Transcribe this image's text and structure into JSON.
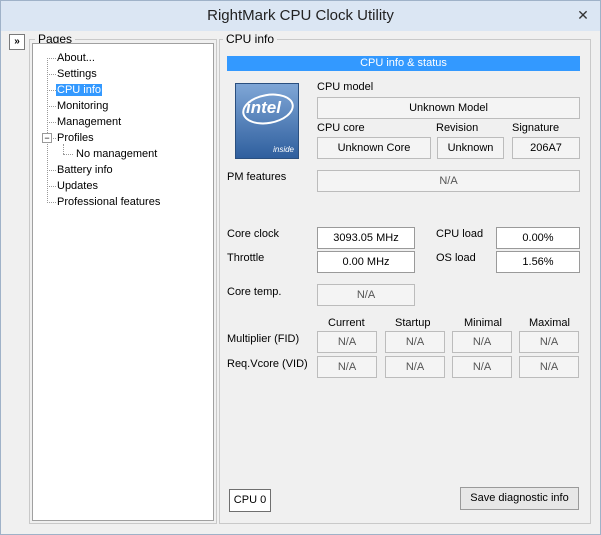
{
  "window": {
    "title": "RightMark CPU Clock Utility",
    "close_glyph": "✕",
    "collapse_glyph": "»"
  },
  "pages": {
    "group_label": "Pages",
    "items": [
      "About...",
      "Settings",
      "CPU info",
      "Monitoring",
      "Management",
      "Profiles",
      "No management",
      "Battery info",
      "Updates",
      "Professional features"
    ],
    "selected": "CPU info"
  },
  "cpu_info": {
    "group_label": "CPU info",
    "header": "CPU info & status",
    "logo_word": "intel",
    "logo_inside": "inside",
    "model_label": "CPU model",
    "model_value": "Unknown Model",
    "core_label": "CPU core",
    "core_value": "Unknown Core",
    "revision_label": "Revision",
    "revision_value": "Unknown",
    "signature_label": "Signature",
    "signature_value": "206A7",
    "pm_label": "PM features",
    "pm_value": "N/A",
    "core_clock_label": "Core clock",
    "core_clock_value": "3093.05 MHz",
    "throttle_label": "Throttle",
    "throttle_value": "0.00 MHz",
    "cpu_load_label": "CPU load",
    "cpu_load_value": "0.00%",
    "os_load_label": "OS load",
    "os_load_value": "1.56%",
    "core_temp_label": "Core temp.",
    "core_temp_value": "N/A",
    "columns": [
      "Current",
      "Startup",
      "Minimal",
      "Maximal"
    ],
    "multiplier_label": "Multiplier (FID)",
    "multiplier_values": [
      "N/A",
      "N/A",
      "N/A",
      "N/A"
    ],
    "vcore_label": "Req.Vcore (VID)",
    "vcore_values": [
      "N/A",
      "N/A",
      "N/A",
      "N/A"
    ]
  },
  "footer": {
    "cpu_selector": "CPU 0",
    "save_button": "Save diagnostic info"
  }
}
